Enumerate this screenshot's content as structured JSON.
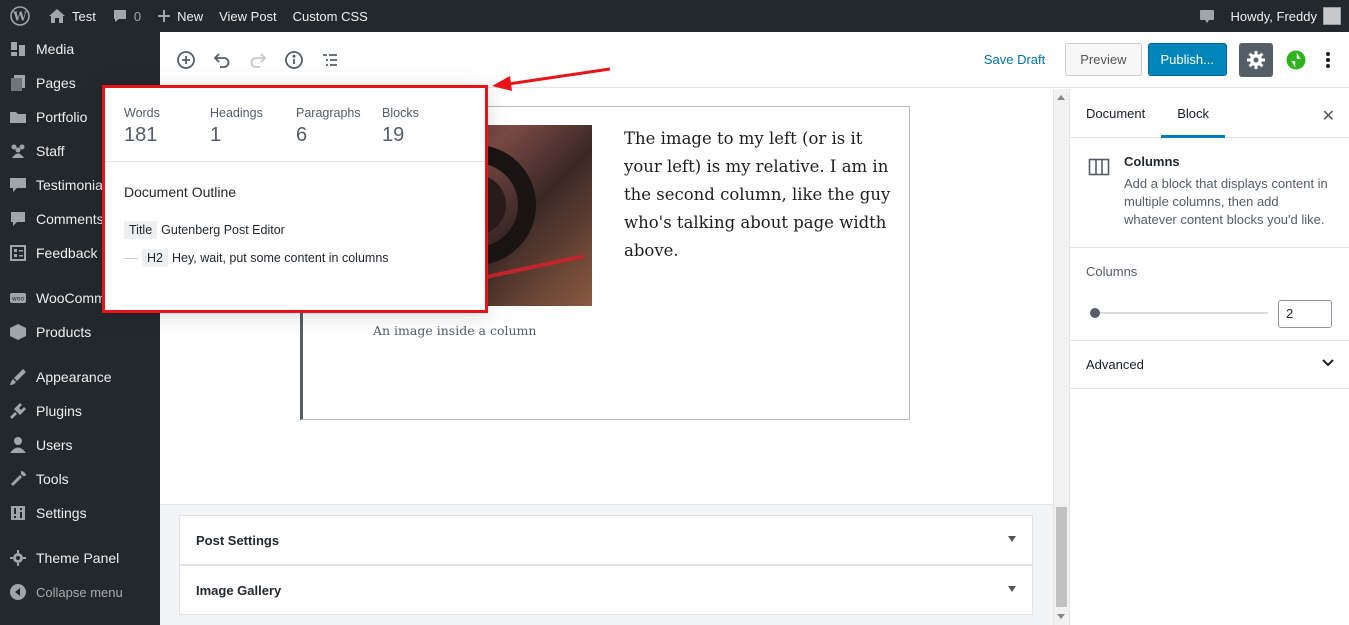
{
  "admin_bar": {
    "site_name": "Test",
    "comments_count": "0",
    "new_label": "New",
    "view_post": "View Post",
    "custom_css": "Custom CSS",
    "howdy": "Howdy, Freddy"
  },
  "sidebar": {
    "items": [
      {
        "label": "Media",
        "icon": "media-icon"
      },
      {
        "label": "Pages",
        "icon": "pages-icon"
      },
      {
        "label": "Portfolio",
        "icon": "portfolio-icon"
      },
      {
        "label": "Staff",
        "icon": "staff-icon"
      },
      {
        "label": "Testimonials",
        "icon": "testimonials-icon"
      },
      {
        "label": "Comments",
        "icon": "comments-icon"
      },
      {
        "label": "Feedback",
        "icon": "feedback-icon"
      },
      {
        "label": "WooCommerce",
        "icon": "woocommerce-icon"
      },
      {
        "label": "Products",
        "icon": "products-icon"
      },
      {
        "label": "Appearance",
        "icon": "appearance-icon"
      },
      {
        "label": "Plugins",
        "icon": "plugins-icon"
      },
      {
        "label": "Users",
        "icon": "users-icon"
      },
      {
        "label": "Tools",
        "icon": "tools-icon"
      },
      {
        "label": "Settings",
        "icon": "settings-icon"
      },
      {
        "label": "Theme Panel",
        "icon": "theme-panel-icon"
      }
    ],
    "collapse_label": "Collapse menu"
  },
  "header": {
    "save_draft": "Save Draft",
    "preview": "Preview",
    "publish": "Publish..."
  },
  "info": {
    "counts": [
      {
        "label": "Words",
        "value": "181"
      },
      {
        "label": "Headings",
        "value": "1"
      },
      {
        "label": "Paragraphs",
        "value": "6"
      },
      {
        "label": "Blocks",
        "value": "19"
      }
    ],
    "outline_title": "Document Outline",
    "title_tag": "Title",
    "title_text": "Gutenberg Post Editor",
    "h2_tag": "H2",
    "h2_text": "Hey, wait, put some content in columns"
  },
  "content": {
    "column_text": "The image to my left (or is it your left) is my relative. I am in the second column, like the guy who's talking about page width above.",
    "caption": "An image inside a column"
  },
  "metaboxes": {
    "post_settings": "Post Settings",
    "image_gallery": "Image Gallery"
  },
  "settings": {
    "tab_document": "Document",
    "tab_block": "Block",
    "block_title": "Columns",
    "block_desc": "Add a block that displays content in multiple columns, then add whatever content blocks you'd like.",
    "columns_label": "Columns",
    "columns_value": "2",
    "advanced": "Advanced"
  },
  "colors": {
    "admin_dark": "#23282d",
    "accent_blue": "#0085ba",
    "highlight_red": "#e8141a",
    "jetpack_green": "#2fb41f"
  }
}
